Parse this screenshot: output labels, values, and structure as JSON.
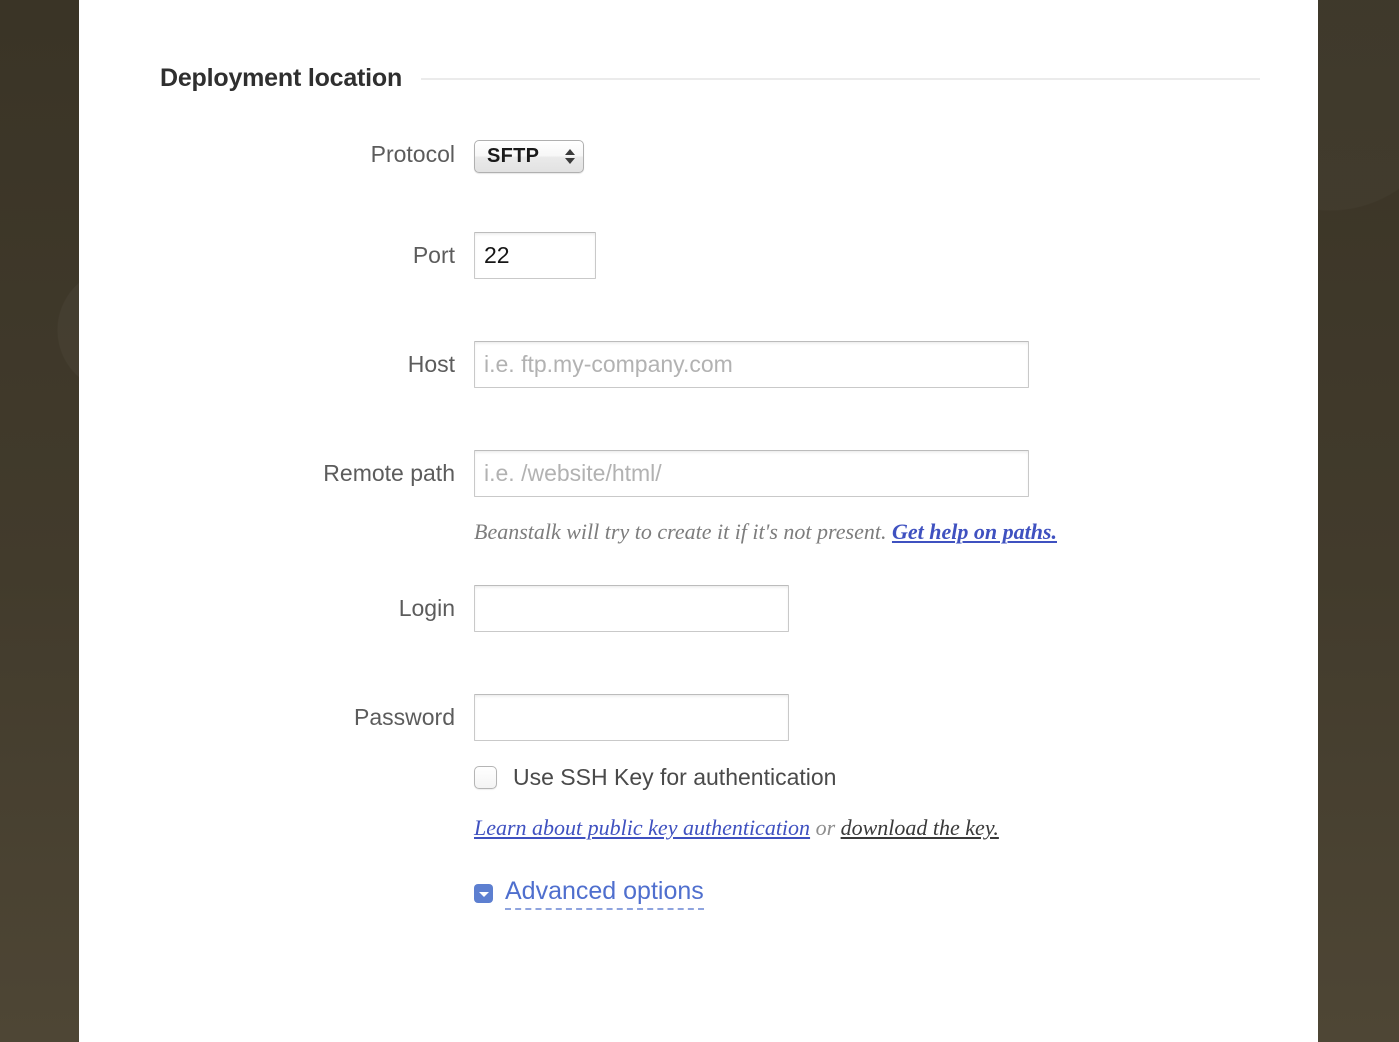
{
  "section": {
    "title": "Deployment location"
  },
  "fields": {
    "protocol": {
      "label": "Protocol",
      "value": "SFTP",
      "options": [
        "SFTP"
      ]
    },
    "port": {
      "label": "Port",
      "value": "22",
      "placeholder": ""
    },
    "host": {
      "label": "Host",
      "value": "",
      "placeholder": "i.e. ftp.my-company.com"
    },
    "remote_path": {
      "label": "Remote path",
      "value": "",
      "placeholder": "i.e. /website/html/",
      "hint_text": "Beanstalk will try to create it if it's not present.",
      "hint_link": "Get help on paths."
    },
    "login": {
      "label": "Login",
      "value": "",
      "placeholder": ""
    },
    "password": {
      "label": "Password",
      "value": "",
      "placeholder": ""
    }
  },
  "ssh": {
    "checkbox_label": "Use SSH Key for authentication",
    "checked": false,
    "learn_link": "Learn about public key authentication",
    "separator": " or ",
    "download_link": "download the key."
  },
  "advanced": {
    "label": "Advanced options",
    "expanded": false
  },
  "colors": {
    "link_blue": "#3f51c0",
    "advanced_blue": "#4f6fce",
    "advanced_icon_blue": "#5d7fd0",
    "label_gray": "#5c5c5c",
    "heading": "#2f2f2f",
    "placeholder": "#b2b2b2",
    "note_gray": "#7d7d7d",
    "backdrop": "#3a3426",
    "panel": "#ffffff",
    "rule": "#ebebeb"
  }
}
